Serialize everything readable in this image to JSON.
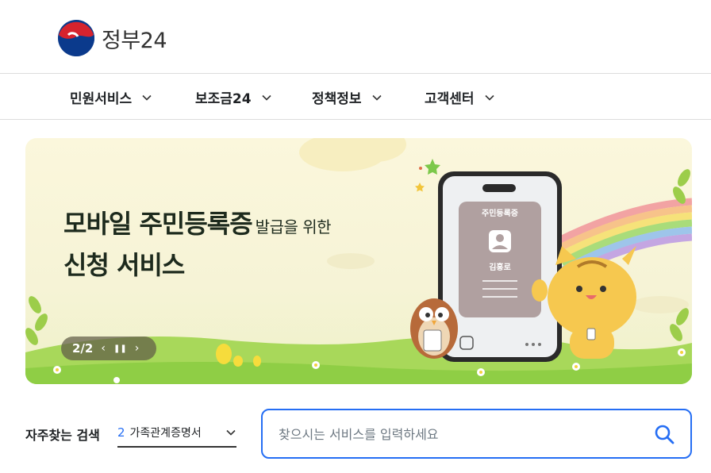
{
  "header": {
    "logo_text": "정부24"
  },
  "nav": {
    "items": [
      {
        "label": "민원서비스"
      },
      {
        "label": "보조금24"
      },
      {
        "label": "정책정보"
      },
      {
        "label": "고객센터"
      }
    ]
  },
  "banner": {
    "title_line1": "모바일 주민등록증",
    "title_line1_sub": "발급을 위한",
    "title_line2": "신청 서비스",
    "card_title": "주민등록증",
    "card_name": "김홍로",
    "pager": {
      "count": "2/2",
      "prev_icon": "chevron-left-icon",
      "pause_icon": "pause-icon",
      "next_icon": "chevron-right-icon"
    }
  },
  "search": {
    "freq_label": "자주찾는 검색",
    "freq_rank": "2",
    "freq_term": "가족관계증명서",
    "placeholder": "찾으시는 서비스를 입력하세요",
    "value": ""
  },
  "colors": {
    "accent": "#256ef4",
    "banner_bg": "#f6f3d6",
    "grass": "#8fce45"
  }
}
